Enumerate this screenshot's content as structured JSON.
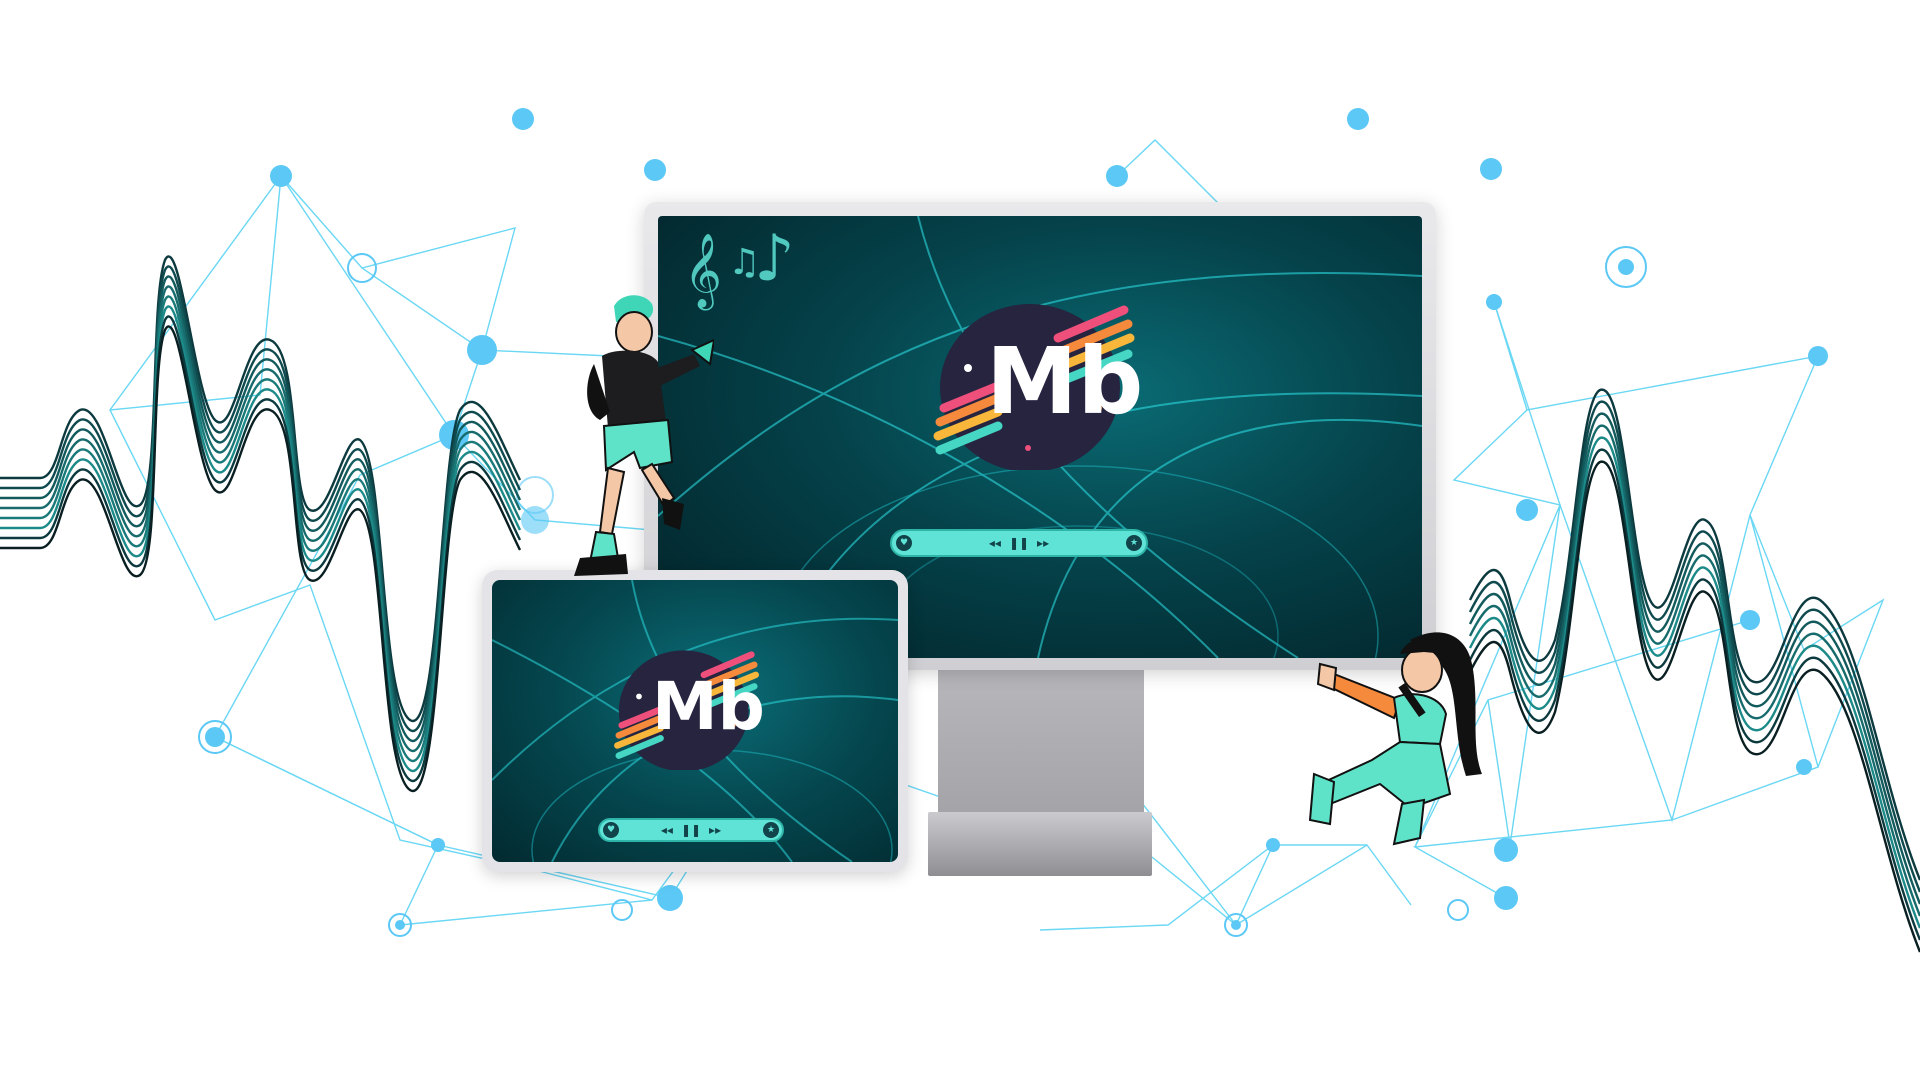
{
  "logo": {
    "letters": "Mb",
    "colors": {
      "circle": "#26243f",
      "stripe_pink": "#ee4f7b",
      "stripe_orange": "#f58a3c",
      "stripe_yellow": "#f8b73b",
      "stripe_teal": "#45d6c4"
    }
  },
  "player": {
    "left_icon": "heart-icon",
    "prev_label": "◂◂",
    "pause_label": "❚❚",
    "next_label": "▸▸",
    "right_icon": "star-icon",
    "left_glyph": "♥",
    "right_glyph": "★"
  },
  "notes": {
    "treble_clef": "𝄞",
    "eighth_notes": "♫",
    "single_note": "♪"
  },
  "colors": {
    "network": "#5ad3f3",
    "node": "#5bc8f5",
    "wave_dark": "#0c3a3f",
    "wave_teal": "#1c8a88",
    "screen_teal": "#0a6b74",
    "accent": "#5fe3d6"
  },
  "characters": {
    "left": "man-with-trumpet",
    "right": "woman-singing"
  }
}
